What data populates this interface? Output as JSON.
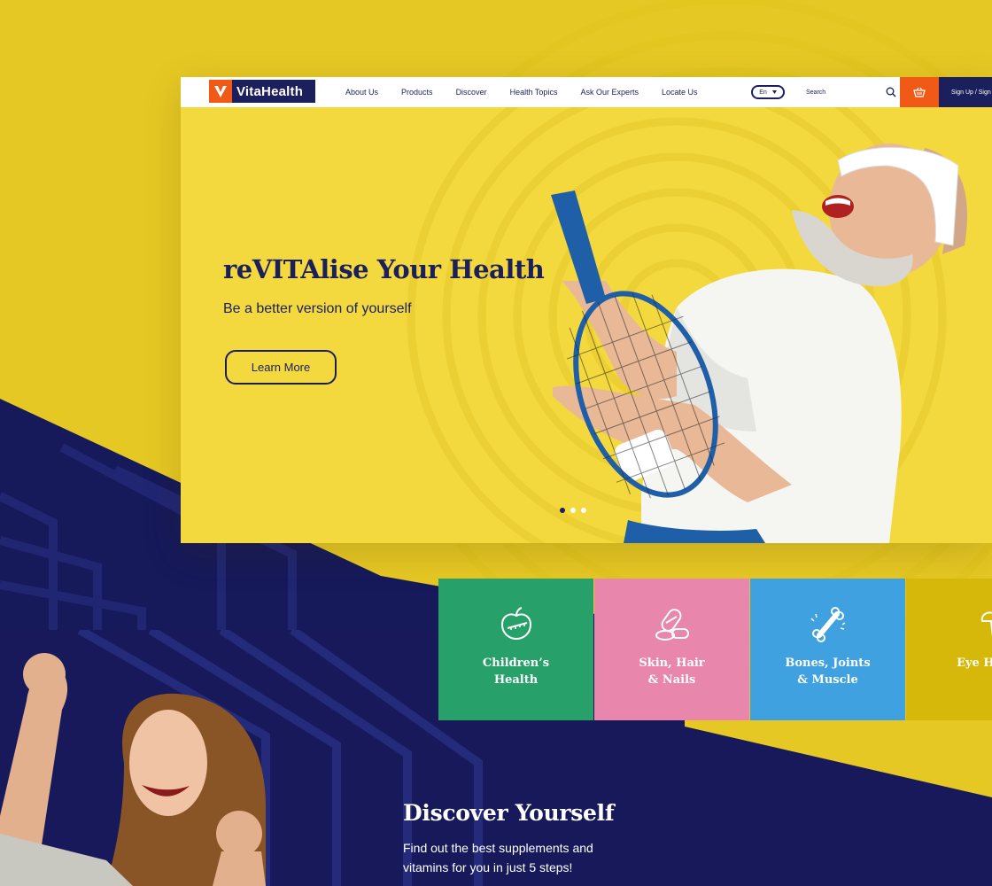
{
  "brand": {
    "name": "VitaHealth"
  },
  "nav": {
    "links": [
      "About Us",
      "Products",
      "Discover",
      "Health Topics",
      "Ask Our Experts",
      "Locate Us"
    ],
    "language": "En",
    "search_label": "Search",
    "signup_label": "Sign Up / Sign In"
  },
  "hero": {
    "title": "reVITAlise Your Health",
    "subtitle": "Be a better version of yourself",
    "cta": "Learn More",
    "slides": {
      "count": 3,
      "active": 1
    }
  },
  "categories": [
    {
      "label": "Children’s\nHealth",
      "color": "#27a06a",
      "icon": "apple-measure-icon"
    },
    {
      "label": "Skin, Hair\n& Nails",
      "color": "#e886ab",
      "icon": "capsules-icon"
    },
    {
      "label": "Bones, Joints\n& Muscle",
      "color": "#3fa1e0",
      "icon": "bone-icon"
    },
    {
      "label": "Eye He",
      "color": "#d6b80a",
      "icon": "broccoli-icon"
    }
  ],
  "discover": {
    "title": "Discover Yourself",
    "text": "Find out the best supplements and vitamins for you in just 5 steps!"
  },
  "colors": {
    "navy": "#1b1f5c",
    "orange": "#f05a16",
    "yellow": "#f3d93e",
    "background": "#e6c824"
  }
}
